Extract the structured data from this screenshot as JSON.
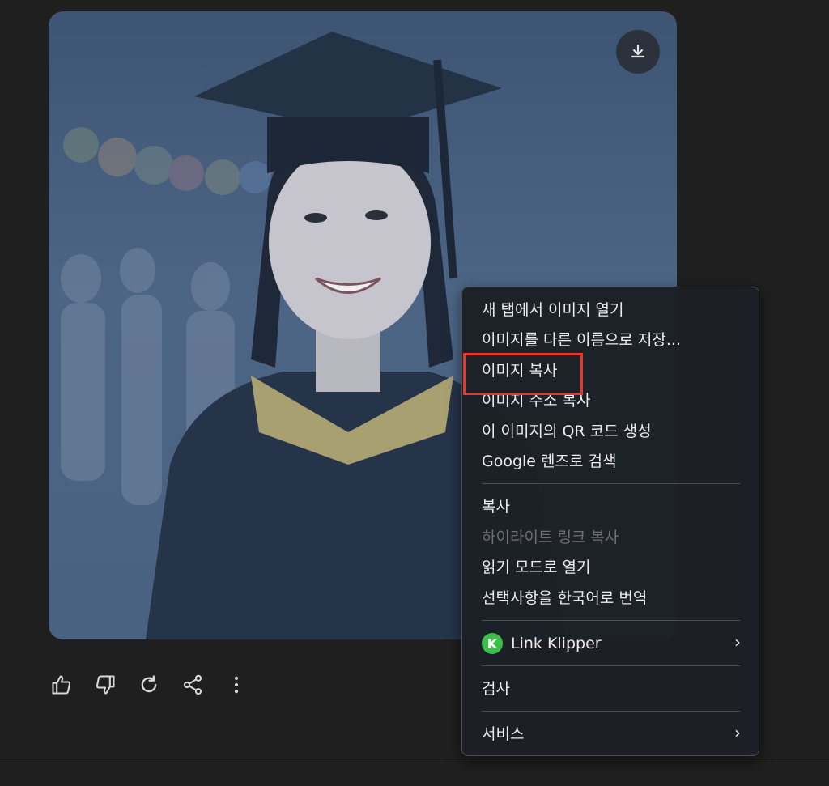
{
  "image": {
    "description_icon": "download-icon"
  },
  "actions": {
    "icons": [
      "thumbs-up-icon",
      "thumbs-down-icon",
      "regenerate-icon",
      "share-icon",
      "more-icon"
    ]
  },
  "context_menu": {
    "items": [
      {
        "label": "새 탭에서 이미지 열기",
        "enabled": true
      },
      {
        "label": "이미지를 다른 이름으로 저장...",
        "enabled": true
      },
      {
        "label": "이미지 복사",
        "enabled": true,
        "highlighted": true
      },
      {
        "label": "이미지 주소 복사",
        "enabled": true
      },
      {
        "label": "이 이미지의 QR 코드 생성",
        "enabled": true
      },
      {
        "label": "Google 렌즈로 검색",
        "enabled": true
      },
      {
        "label": "복사",
        "enabled": true
      },
      {
        "label": "하이라이트 링크 복사",
        "enabled": false
      },
      {
        "label": "읽기 모드로 열기",
        "enabled": true
      },
      {
        "label": "선택사항을 한국어로 번역",
        "enabled": true
      },
      {
        "label": "Link Klipper",
        "enabled": true,
        "submenu": true,
        "icon_letter": "K"
      },
      {
        "label": "검사",
        "enabled": true
      },
      {
        "label": "서비스",
        "enabled": true,
        "submenu": true
      }
    ]
  },
  "colors": {
    "highlight": "#e53a2a",
    "link_klipper_green": "#3bbf4b"
  }
}
